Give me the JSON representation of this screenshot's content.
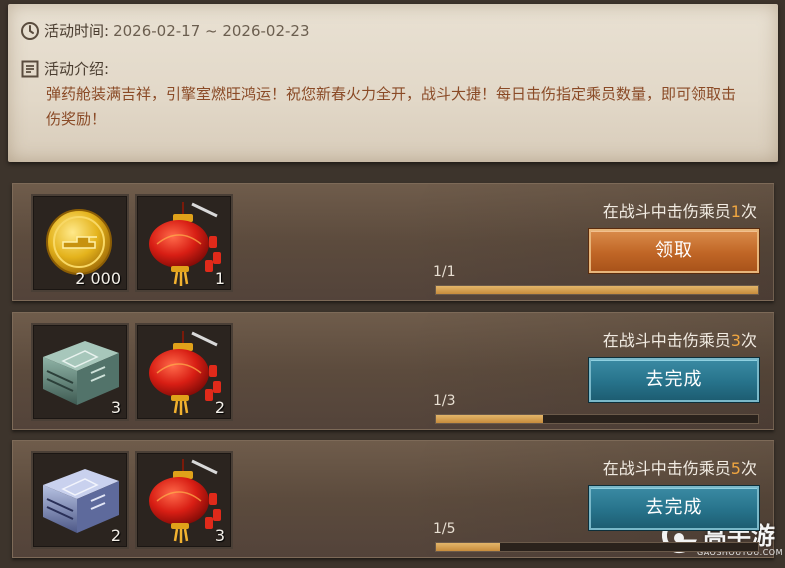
{
  "info": {
    "time_label": "活动时间:",
    "time_value": "2026-02-17 ~ 2026-02-23",
    "intro_label": "活动介绍:",
    "intro_text": "弹药舱装满吉祥，引擎室燃旺鸿运！祝您新春火力全开，战斗大捷！每日击伤指定乘员数量，即可领取击伤奖励！"
  },
  "tasks": [
    {
      "title_prefix": "在战斗中击伤乘员",
      "count": "1",
      "title_suffix": "次",
      "progress_text": "1/1",
      "progress": 1.0,
      "button": "领取",
      "button_style": "claim",
      "rewards": [
        {
          "icon": "gold-coin-icon",
          "qty": "2 000"
        },
        {
          "icon": "red-lantern-icon",
          "qty": "1"
        }
      ]
    },
    {
      "title_prefix": "在战斗中击伤乘员",
      "count": "3",
      "title_suffix": "次",
      "progress_text": "1/3",
      "progress": 0.333,
      "button": "去完成",
      "button_style": "go",
      "rewards": [
        {
          "icon": "green-crate-icon",
          "qty": "3"
        },
        {
          "icon": "red-lantern-icon",
          "qty": "2"
        }
      ]
    },
    {
      "title_prefix": "在战斗中击伤乘员",
      "count": "5",
      "title_suffix": "次",
      "progress_text": "1/5",
      "progress": 0.2,
      "button": "去完成",
      "button_style": "go",
      "rewards": [
        {
          "icon": "blue-crate-icon",
          "qty": "2"
        },
        {
          "icon": "red-lantern-icon",
          "qty": "3"
        }
      ]
    }
  ],
  "watermark": {
    "name": "高手游",
    "domain": "GAOSHOUYOU.COM"
  },
  "colors": {
    "accent_count": "#f0a640",
    "claim": "#c06626",
    "go": "#27738b",
    "progress": "#d9a456"
  }
}
